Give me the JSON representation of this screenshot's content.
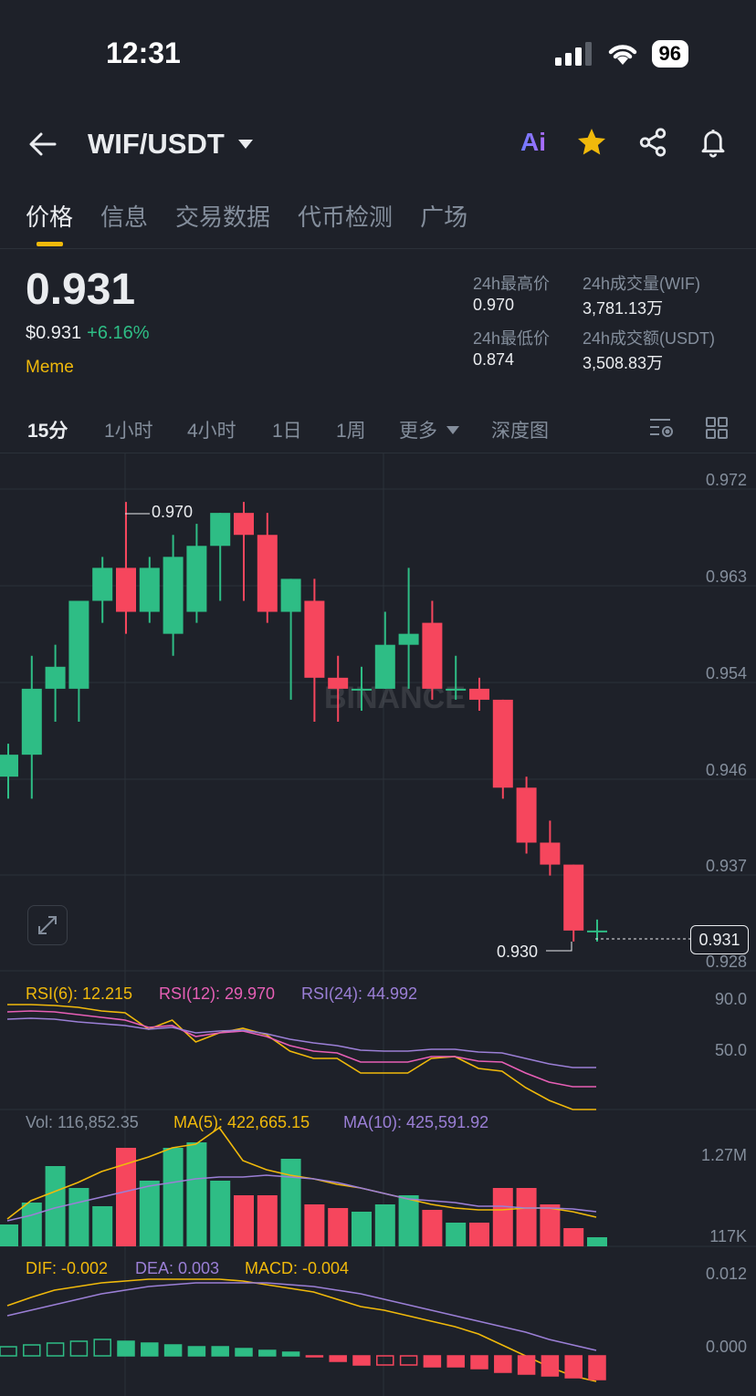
{
  "status": {
    "time": "12:31",
    "battery": "96"
  },
  "header": {
    "pair": "WIF/USDT",
    "ai_label": "Ai"
  },
  "tabs": [
    "价格",
    "信息",
    "交易数据",
    "代币检测",
    "广场"
  ],
  "price": {
    "last": "0.931",
    "usd": "$0.931",
    "change": "+6.16%",
    "tag": "Meme"
  },
  "stats": {
    "high_label": "24h最高价",
    "high": "0.970",
    "low_label": "24h最低价",
    "low": "0.874",
    "vol_label": "24h成交量(WIF)",
    "vol": "3,781.13万",
    "amt_label": "24h成交额(USDT)",
    "amt": "3,508.83万"
  },
  "timeframes": [
    "15分",
    "1小时",
    "4小时",
    "1日",
    "1周",
    "更多",
    "深度图"
  ],
  "chart_data": {
    "type": "candlestick",
    "y_ticks": [
      "0.972",
      "0.963",
      "0.954",
      "0.946",
      "0.937",
      "0.928"
    ],
    "y_range": [
      0.928,
      0.972
    ],
    "current_price_label": "0.931",
    "high_marker": "0.970",
    "low_marker": "0.930",
    "candles": [
      {
        "o": 0.945,
        "h": 0.948,
        "l": 0.943,
        "c": 0.947
      },
      {
        "o": 0.947,
        "h": 0.956,
        "l": 0.943,
        "c": 0.953
      },
      {
        "o": 0.953,
        "h": 0.957,
        "l": 0.95,
        "c": 0.955
      },
      {
        "o": 0.953,
        "h": 0.961,
        "l": 0.95,
        "c": 0.961
      },
      {
        "o": 0.961,
        "h": 0.965,
        "l": 0.959,
        "c": 0.964
      },
      {
        "o": 0.964,
        "h": 0.97,
        "l": 0.958,
        "c": 0.96
      },
      {
        "o": 0.96,
        "h": 0.965,
        "l": 0.959,
        "c": 0.964
      },
      {
        "o": 0.958,
        "h": 0.967,
        "l": 0.956,
        "c": 0.965
      },
      {
        "o": 0.96,
        "h": 0.968,
        "l": 0.959,
        "c": 0.966
      },
      {
        "o": 0.966,
        "h": 0.969,
        "l": 0.961,
        "c": 0.969
      },
      {
        "o": 0.969,
        "h": 0.97,
        "l": 0.961,
        "c": 0.967
      },
      {
        "o": 0.967,
        "h": 0.969,
        "l": 0.959,
        "c": 0.96
      },
      {
        "o": 0.96,
        "h": 0.963,
        "l": 0.952,
        "c": 0.963
      },
      {
        "o": 0.961,
        "h": 0.963,
        "l": 0.95,
        "c": 0.954
      },
      {
        "o": 0.954,
        "h": 0.956,
        "l": 0.95,
        "c": 0.953
      },
      {
        "o": 0.953,
        "h": 0.955,
        "l": 0.951,
        "c": 0.953
      },
      {
        "o": 0.953,
        "h": 0.96,
        "l": 0.953,
        "c": 0.957
      },
      {
        "o": 0.957,
        "h": 0.964,
        "l": 0.953,
        "c": 0.958
      },
      {
        "o": 0.959,
        "h": 0.961,
        "l": 0.952,
        "c": 0.953
      },
      {
        "o": 0.953,
        "h": 0.956,
        "l": 0.952,
        "c": 0.953
      },
      {
        "o": 0.953,
        "h": 0.954,
        "l": 0.951,
        "c": 0.952
      },
      {
        "o": 0.952,
        "h": 0.952,
        "l": 0.943,
        "c": 0.944
      },
      {
        "o": 0.944,
        "h": 0.945,
        "l": 0.938,
        "c": 0.939
      },
      {
        "o": 0.939,
        "h": 0.941,
        "l": 0.936,
        "c": 0.937
      },
      {
        "o": 0.937,
        "h": 0.937,
        "l": 0.93,
        "c": 0.931
      },
      {
        "o": 0.931,
        "h": 0.932,
        "l": 0.93,
        "c": 0.931
      }
    ],
    "rsi": {
      "label6": "RSI(6): 12.215",
      "label12": "RSI(12): 29.970",
      "label24": "RSI(24): 44.992",
      "ticks": [
        "90.0",
        "50.0"
      ]
    },
    "volume": {
      "label": "Vol: 116,852.35",
      "ma5": "MA(5): 422,665.15",
      "ma10": "MA(10): 425,591.92",
      "ticks": [
        "1.27M",
        "117K"
      ]
    },
    "macd": {
      "dif": "DIF: -0.002",
      "dea": "DEA: 0.003",
      "macd": "MACD: -0.004",
      "ticks": [
        "0.012",
        "0.000"
      ]
    }
  },
  "colors": {
    "up": "#2ebd85",
    "down": "#f6465d",
    "accent": "#f0b90b",
    "bg": "#1e2129"
  }
}
